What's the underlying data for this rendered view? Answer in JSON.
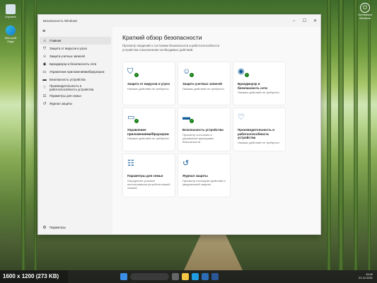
{
  "window": {
    "title": "Безопасность Windows"
  },
  "desktop": {
    "icons": [
      {
        "label": "Корзина"
      },
      {
        "label": "Microsoft Edge"
      }
    ],
    "top_right_label": "Активация Windows"
  },
  "sidebar": {
    "items": [
      {
        "label": "Главная",
        "icon": "home-icon",
        "active": true
      },
      {
        "label": "Защита от вирусов и угроз",
        "icon": "shield-icon"
      },
      {
        "label": "Защита учетных записей",
        "icon": "person-icon"
      },
      {
        "label": "Брандмауэр и безопасность сети",
        "icon": "wifi-icon"
      },
      {
        "label": "Управление приложениями/браузером",
        "icon": "app-icon"
      },
      {
        "label": "Безопасность устройства",
        "icon": "laptop-icon"
      },
      {
        "label": "Производительность и работоспособность устройства",
        "icon": "heart-icon"
      },
      {
        "label": "Параметры для семьи",
        "icon": "family-icon"
      },
      {
        "label": "Журнал защиты",
        "icon": "history-icon"
      }
    ],
    "settings_label": "Параметры"
  },
  "main": {
    "title": "Краткий обзор безопасности",
    "subtitle": "Просмотр сведений о состоянии безопасности и работоспособности устройства и выполнение необходимых действий.",
    "cards": [
      {
        "title": "Защита от вирусов и угроз",
        "desc": "Никаких действий не требуется.",
        "icon": "shield-icon",
        "ok": true
      },
      {
        "title": "Защита учетных записей",
        "desc": "Никаких действий не требуется.",
        "icon": "person-icon",
        "ok": true
      },
      {
        "title": "Брандмауэр и безопасность сети",
        "desc": "Никаких действий не требуется.",
        "icon": "wifi-icon",
        "ok": true
      },
      {
        "title": "Управление приложениями/браузером",
        "desc": "Никаких действий не требуется.",
        "icon": "app-icon",
        "ok": true
      },
      {
        "title": "Безопасность устройства",
        "desc": "Просмотр состояния и управление функциями безопасности.",
        "icon": "laptop-icon",
        "ok": true
      },
      {
        "title": "Производительность и работоспособность устройства",
        "desc": "Никаких действий не требуется.",
        "icon": "heart-icon",
        "ok": false
      },
      {
        "title": "Параметры для семьи",
        "desc": "Определите условия использования устройств вашей семьей.",
        "icon": "family-icon",
        "ok": false
      },
      {
        "title": "Журнал защиты",
        "desc": "Просмотр последних действий и уведомлений защиты.",
        "icon": "history-icon",
        "ok": false
      }
    ]
  },
  "taskbar": {
    "time": "19:42",
    "date": "21.12.2021"
  },
  "caption": "1600 x 1200 (273 KB)"
}
